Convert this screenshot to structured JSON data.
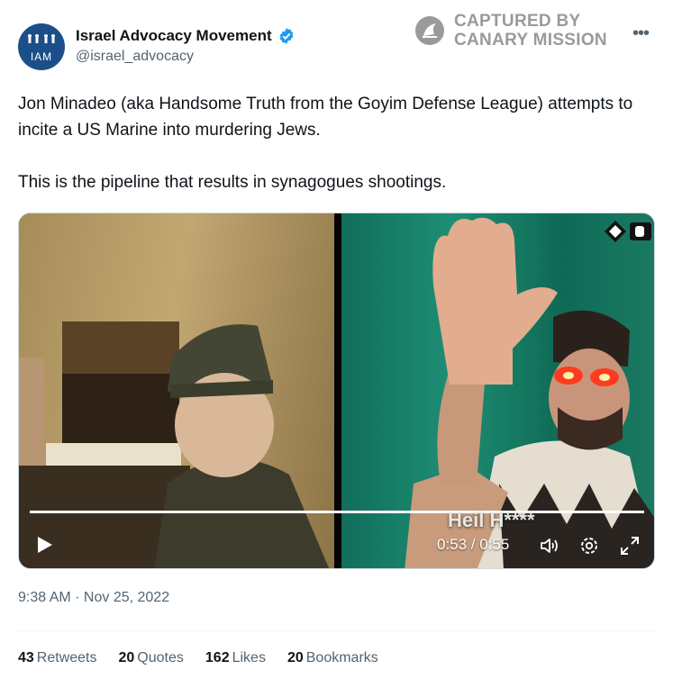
{
  "account": {
    "display_name": "Israel Advocacy Movement",
    "handle": "@israel_advocacy",
    "avatar_text": "IAM",
    "verified": true
  },
  "watermark": {
    "line1": "CAPTURED BY",
    "line2": "CANARY MISSION"
  },
  "tweet": {
    "paragraphs": [
      "Jon Minadeo (aka Handsome Truth from the Goyim Defense League) attempts to incite a US Marine into murdering Jews.",
      "This is the pipeline that results in synagogues shootings."
    ],
    "timestamp": "9:38 AM · Nov 25, 2022"
  },
  "video": {
    "caption": "Heil H****",
    "current_time": "0:53",
    "duration": "0:55",
    "time_display": "0:53 / 0:55",
    "progress": 0.96,
    "overlay_logo": "gd-logo"
  },
  "stats": [
    {
      "count": "43",
      "label": "Retweets"
    },
    {
      "count": "20",
      "label": "Quotes"
    },
    {
      "count": "162",
      "label": "Likes"
    },
    {
      "count": "20",
      "label": "Bookmarks"
    }
  ],
  "colors": {
    "text": "#0f1419",
    "secondary": "#536471",
    "verified": "#1d9bf0",
    "avatar_bg": "#1c4f8a",
    "watermark": "#9a9a9a"
  },
  "icons": [
    "verified-badge-icon",
    "canary-mission-logo",
    "more-icon",
    "play-icon",
    "volume-icon",
    "settings-gear-icon",
    "fullscreen-icon"
  ]
}
